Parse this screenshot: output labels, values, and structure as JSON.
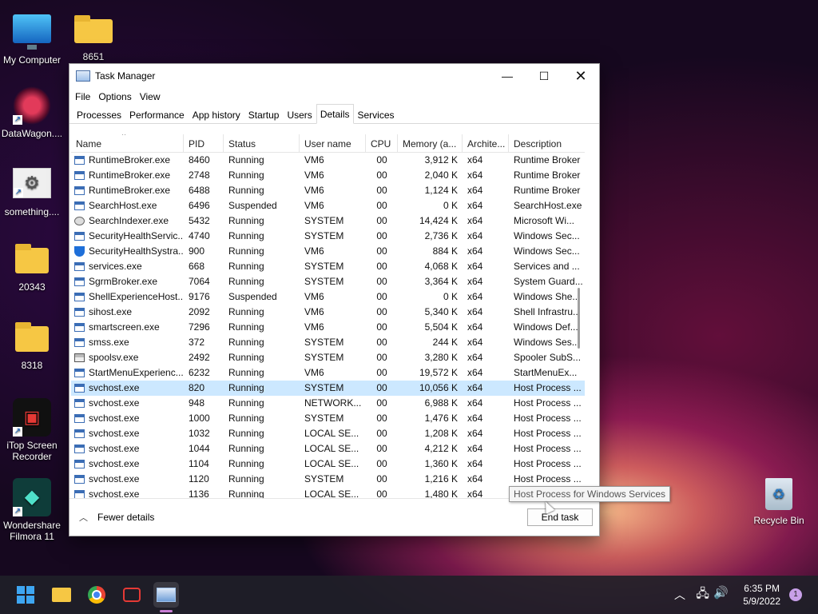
{
  "desktop": {
    "icons": [
      {
        "label": "My Computer"
      },
      {
        "label": "8651"
      },
      {
        "label": "DataWagon...."
      },
      {
        "label": "something...."
      },
      {
        "label": "20343"
      },
      {
        "label": "8318"
      },
      {
        "label": "iTop Screen Recorder"
      },
      {
        "label": "Wondershare Filmora 11"
      },
      {
        "label": "Recycle Bin"
      }
    ]
  },
  "window": {
    "title": "Task Manager",
    "menu": [
      "File",
      "Options",
      "View"
    ],
    "tabs": [
      "Processes",
      "Performance",
      "App history",
      "Startup",
      "Users",
      "Details",
      "Services"
    ],
    "active_tab": "Details",
    "columns": [
      "Name",
      "PID",
      "Status",
      "User name",
      "CPU",
      "Memory (a...",
      "Archite...",
      "Description"
    ],
    "rows": [
      {
        "name": "RuntimeBroker.exe",
        "pid": "8460",
        "status": "Running",
        "user": "VM6",
        "cpu": "00",
        "mem": "3,912 K",
        "arch": "x64",
        "desc": "Runtime Broker",
        "icon": "process"
      },
      {
        "name": "RuntimeBroker.exe",
        "pid": "2748",
        "status": "Running",
        "user": "VM6",
        "cpu": "00",
        "mem": "2,040 K",
        "arch": "x64",
        "desc": "Runtime Broker",
        "icon": "process"
      },
      {
        "name": "RuntimeBroker.exe",
        "pid": "6488",
        "status": "Running",
        "user": "VM6",
        "cpu": "00",
        "mem": "1,124 K",
        "arch": "x64",
        "desc": "Runtime Broker",
        "icon": "process"
      },
      {
        "name": "SearchHost.exe",
        "pid": "6496",
        "status": "Suspended",
        "user": "VM6",
        "cpu": "00",
        "mem": "0 K",
        "arch": "x64",
        "desc": "SearchHost.exe",
        "icon": "process"
      },
      {
        "name": "SearchIndexer.exe",
        "pid": "5432",
        "status": "Running",
        "user": "SYSTEM",
        "cpu": "00",
        "mem": "14,424 K",
        "arch": "x64",
        "desc": "Microsoft Wi...",
        "icon": "search"
      },
      {
        "name": "SecurityHealthServic...",
        "pid": "4740",
        "status": "Running",
        "user": "SYSTEM",
        "cpu": "00",
        "mem": "2,736 K",
        "arch": "x64",
        "desc": "Windows Sec...",
        "icon": "process"
      },
      {
        "name": "SecurityHealthSystra...",
        "pid": "900",
        "status": "Running",
        "user": "VM6",
        "cpu": "00",
        "mem": "884 K",
        "arch": "x64",
        "desc": "Windows Sec...",
        "icon": "shield"
      },
      {
        "name": "services.exe",
        "pid": "668",
        "status": "Running",
        "user": "SYSTEM",
        "cpu": "00",
        "mem": "4,068 K",
        "arch": "x64",
        "desc": "Services and ...",
        "icon": "process"
      },
      {
        "name": "SgrmBroker.exe",
        "pid": "7064",
        "status": "Running",
        "user": "SYSTEM",
        "cpu": "00",
        "mem": "3,364 K",
        "arch": "x64",
        "desc": "System Guard...",
        "icon": "process"
      },
      {
        "name": "ShellExperienceHost....",
        "pid": "9176",
        "status": "Suspended",
        "user": "VM6",
        "cpu": "00",
        "mem": "0 K",
        "arch": "x64",
        "desc": "Windows She...",
        "icon": "process"
      },
      {
        "name": "sihost.exe",
        "pid": "2092",
        "status": "Running",
        "user": "VM6",
        "cpu": "00",
        "mem": "5,340 K",
        "arch": "x64",
        "desc": "Shell Infrastru...",
        "icon": "process"
      },
      {
        "name": "smartscreen.exe",
        "pid": "7296",
        "status": "Running",
        "user": "VM6",
        "cpu": "00",
        "mem": "5,504 K",
        "arch": "x64",
        "desc": "Windows Def...",
        "icon": "process"
      },
      {
        "name": "smss.exe",
        "pid": "372",
        "status": "Running",
        "user": "SYSTEM",
        "cpu": "00",
        "mem": "244 K",
        "arch": "x64",
        "desc": "Windows Ses...",
        "icon": "process"
      },
      {
        "name": "spoolsv.exe",
        "pid": "2492",
        "status": "Running",
        "user": "SYSTEM",
        "cpu": "00",
        "mem": "3,280 K",
        "arch": "x64",
        "desc": "Spooler SubS...",
        "icon": "printer"
      },
      {
        "name": "StartMenuExperienc...",
        "pid": "6232",
        "status": "Running",
        "user": "VM6",
        "cpu": "00",
        "mem": "19,572 K",
        "arch": "x64",
        "desc": "StartMenuEx...",
        "icon": "process"
      },
      {
        "name": "svchost.exe",
        "pid": "820",
        "status": "Running",
        "user": "SYSTEM",
        "cpu": "00",
        "mem": "10,056 K",
        "arch": "x64",
        "desc": "Host Process ...",
        "icon": "process",
        "selected": true
      },
      {
        "name": "svchost.exe",
        "pid": "948",
        "status": "Running",
        "user": "NETWORK...",
        "cpu": "00",
        "mem": "6,988 K",
        "arch": "x64",
        "desc": "Host Process ...",
        "icon": "process"
      },
      {
        "name": "svchost.exe",
        "pid": "1000",
        "status": "Running",
        "user": "SYSTEM",
        "cpu": "00",
        "mem": "1,476 K",
        "arch": "x64",
        "desc": "Host Process ...",
        "icon": "process"
      },
      {
        "name": "svchost.exe",
        "pid": "1032",
        "status": "Running",
        "user": "LOCAL SE...",
        "cpu": "00",
        "mem": "1,208 K",
        "arch": "x64",
        "desc": "Host Process ...",
        "icon": "process"
      },
      {
        "name": "svchost.exe",
        "pid": "1044",
        "status": "Running",
        "user": "LOCAL SE...",
        "cpu": "00",
        "mem": "4,212 K",
        "arch": "x64",
        "desc": "Host Process ...",
        "icon": "process"
      },
      {
        "name": "svchost.exe",
        "pid": "1104",
        "status": "Running",
        "user": "LOCAL SE...",
        "cpu": "00",
        "mem": "1,360 K",
        "arch": "x64",
        "desc": "Host Process ...",
        "icon": "process"
      },
      {
        "name": "svchost.exe",
        "pid": "1120",
        "status": "Running",
        "user": "SYSTEM",
        "cpu": "00",
        "mem": "1,216 K",
        "arch": "x64",
        "desc": "Host Process ...",
        "icon": "process"
      },
      {
        "name": "svchost.exe",
        "pid": "1136",
        "status": "Running",
        "user": "LOCAL SE...",
        "cpu": "00",
        "mem": "1,480 K",
        "arch": "x64",
        "desc": "Host Process ...",
        "icon": "process"
      }
    ],
    "fewer_details": "Fewer details",
    "end_task": "End task",
    "tooltip": "Host Process for Windows Services"
  },
  "taskbar": {
    "time": "6:35 PM",
    "date": "5/9/2022",
    "notification_count": "1"
  }
}
